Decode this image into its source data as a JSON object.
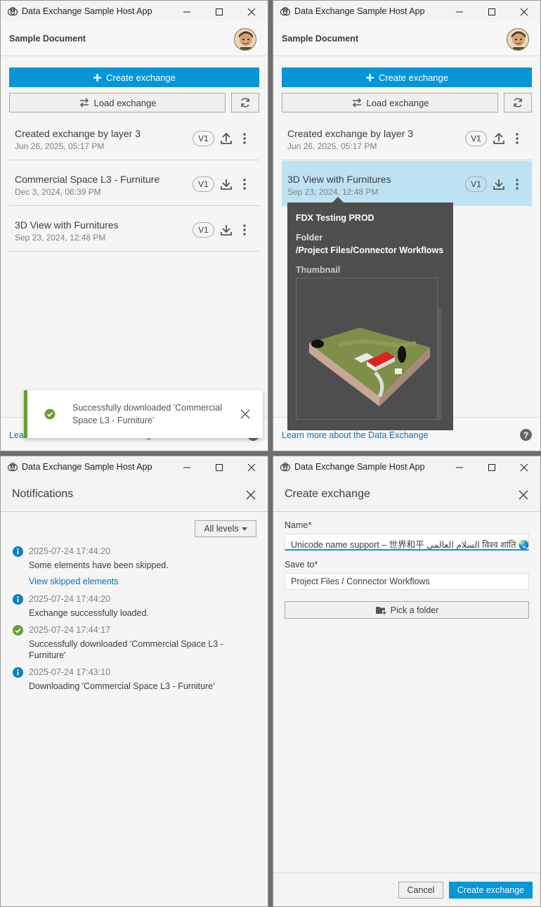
{
  "app": {
    "title": "Data Exchange Sample Host App"
  },
  "document": {
    "title": "Sample Document"
  },
  "actions": {
    "create_label": "Create exchange",
    "load_label": "Load exchange"
  },
  "exchanges": [
    {
      "name": "Created exchange by layer 3",
      "date": "Jun 26, 2025, 05:17 PM",
      "version": "V1",
      "action": "upload-icon"
    },
    {
      "name": "Commercial Space L3 - Furniture",
      "date": "Dec 3, 2024, 06:39 PM",
      "version": "V1",
      "action": "download-icon"
    },
    {
      "name": "3D View with Furnitures",
      "date": "Sep 23, 2024, 12:48 PM",
      "version": "V1",
      "action": "download-icon"
    }
  ],
  "footer": {
    "learn_more": "Learn more about the Data Exchange",
    "learn_more_truncated": "Lea",
    "learn_more_tail": "g",
    "help": "?"
  },
  "toast": {
    "message": "Successfully downloaded 'Commercial Space L3 - Furniture'"
  },
  "tooltip": {
    "project": "FDX Testing PROD",
    "folder_label": "Folder",
    "folder": "/Project Files/Connector Workflows",
    "thumbnail_label": "Thumbnail"
  },
  "notifications": {
    "title": "Notifications",
    "filter": "All levels",
    "items": [
      {
        "level": "info",
        "time": "2025-07-24 17:44:20",
        "message": "Some elements have been skipped.",
        "link": "View skipped elements"
      },
      {
        "level": "info",
        "time": "2025-07-24 17:44:20",
        "message": "Exchange successfully loaded."
      },
      {
        "level": "success",
        "time": "2025-07-24 17:44:17",
        "message": "Successfully downloaded 'Commercial Space L3 - Furniture'"
      },
      {
        "level": "info",
        "time": "2025-07-24 17:43:10",
        "message": "Downloading 'Commercial Space L3 - Furniture'"
      }
    ]
  },
  "create_form": {
    "title": "Create exchange",
    "name_label": "Name",
    "required_mark": "*",
    "name_value": "Unicode name support – 世界和平 السلام العالمي विश्व शांति 🌏",
    "save_to_label": "Save to",
    "save_to_value": "Project Files / Connector Workflows",
    "pick_folder": "Pick a folder",
    "cancel": "Cancel",
    "submit": "Create exchange"
  },
  "colors": {
    "accent": "#0696d7",
    "selected_row": "#bde3f3",
    "success": "#6a9e2f",
    "info": "#0a7fc1",
    "link": "#0a73b8"
  }
}
